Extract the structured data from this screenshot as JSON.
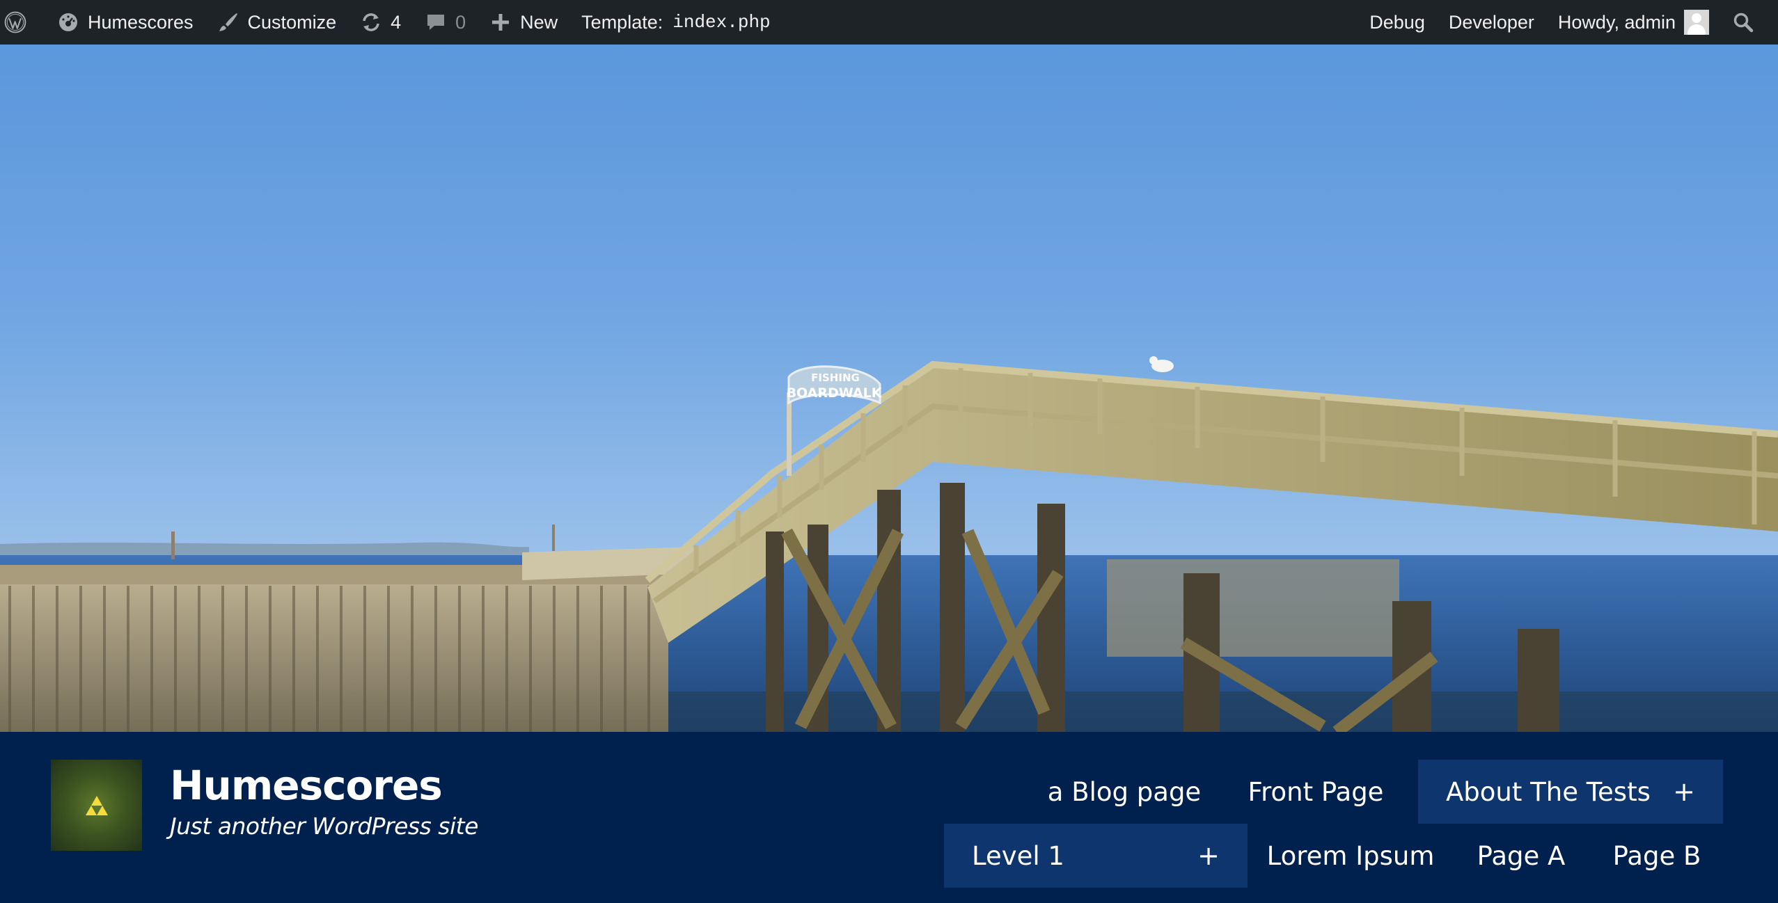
{
  "admin_bar": {
    "wp_logo_icon": "wordpress-logo-icon",
    "site_name": "Humescores",
    "customize": "Customize",
    "updates_count": "4",
    "comments_count": "0",
    "new_label": "New",
    "template_prefix": "Template:",
    "template_file": "index.php",
    "debug": "Debug",
    "developer": "Developer",
    "howdy": "Howdy, admin"
  },
  "site": {
    "title": "Humescores",
    "description": "Just another WordPress site"
  },
  "header_image": {
    "sign_line1": "FISHING",
    "sign_line2": "BOARDWALK"
  },
  "menu": {
    "items": [
      {
        "label": "a Blog page"
      },
      {
        "label": "Front Page"
      },
      {
        "label": "About The Tests",
        "toggle": "+"
      },
      {
        "label": "Level 1",
        "toggle": "+"
      },
      {
        "label": "Lorem Ipsum"
      },
      {
        "label": "Page A"
      },
      {
        "label": "Page B"
      }
    ]
  },
  "colors": {
    "admin_bar_bg": "#1d2327",
    "header_bg": "#00204d",
    "menu_highlight_bg": "#0f356e"
  }
}
